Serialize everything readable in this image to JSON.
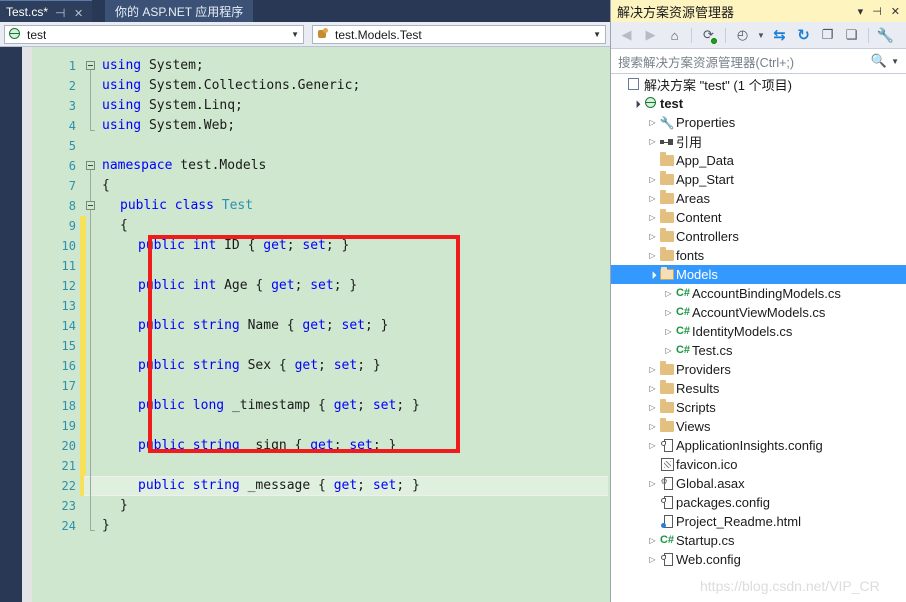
{
  "editor": {
    "tabs": [
      {
        "label": "Test.cs*",
        "active": true,
        "pin_icon": "pin-icon",
        "close_icon": "close-icon"
      },
      {
        "label": "你的 ASP.NET 应用程序",
        "active": false
      }
    ],
    "nav": {
      "project": {
        "value": "test",
        "icon": "project-globe-icon",
        "arrow": "▼"
      },
      "member": {
        "value": "test.Models.Test",
        "icon": "class-icon",
        "arrow": "▼"
      }
    },
    "line_numbers": [
      1,
      2,
      3,
      4,
      5,
      6,
      7,
      8,
      9,
      10,
      11,
      12,
      13,
      14,
      15,
      16,
      17,
      18,
      19,
      20,
      21,
      22,
      23,
      24
    ],
    "current_line": 22,
    "code_lines": [
      {
        "n": 1,
        "indent": 0,
        "tokens": [
          {
            "t": "using ",
            "c": "kw"
          },
          {
            "t": "System;",
            "c": "pl"
          }
        ]
      },
      {
        "n": 2,
        "indent": 0,
        "tokens": [
          {
            "t": "using ",
            "c": "kw"
          },
          {
            "t": "System.Collections.Generic;",
            "c": "pl"
          }
        ]
      },
      {
        "n": 3,
        "indent": 0,
        "tokens": [
          {
            "t": "using ",
            "c": "kw"
          },
          {
            "t": "System.Linq;",
            "c": "pl"
          }
        ]
      },
      {
        "n": 4,
        "indent": 0,
        "tokens": [
          {
            "t": "using ",
            "c": "kw"
          },
          {
            "t": "System.Web;",
            "c": "pl"
          }
        ]
      },
      {
        "n": 5,
        "indent": 0,
        "tokens": []
      },
      {
        "n": 6,
        "indent": 0,
        "tokens": [
          {
            "t": "namespace ",
            "c": "kw"
          },
          {
            "t": "test.Models",
            "c": "pl"
          }
        ]
      },
      {
        "n": 7,
        "indent": 0,
        "tokens": [
          {
            "t": "{",
            "c": "pl"
          }
        ]
      },
      {
        "n": 8,
        "indent": 1,
        "tokens": [
          {
            "t": "public ",
            "c": "kw"
          },
          {
            "t": "class ",
            "c": "kw"
          },
          {
            "t": "Test",
            "c": "ty"
          }
        ]
      },
      {
        "n": 9,
        "indent": 1,
        "tokens": [
          {
            "t": "{",
            "c": "pl"
          }
        ]
      },
      {
        "n": 10,
        "indent": 2,
        "tokens": [
          {
            "t": "public ",
            "c": "kw"
          },
          {
            "t": "int ",
            "c": "kw"
          },
          {
            "t": "ID { ",
            "c": "pl"
          },
          {
            "t": "get",
            "c": "kw"
          },
          {
            "t": "; ",
            "c": "pl"
          },
          {
            "t": "set",
            "c": "kw"
          },
          {
            "t": "; }",
            "c": "pl"
          }
        ]
      },
      {
        "n": 11,
        "indent": 2,
        "tokens": []
      },
      {
        "n": 12,
        "indent": 2,
        "tokens": [
          {
            "t": "public ",
            "c": "kw"
          },
          {
            "t": "int ",
            "c": "kw"
          },
          {
            "t": "Age { ",
            "c": "pl"
          },
          {
            "t": "get",
            "c": "kw"
          },
          {
            "t": "; ",
            "c": "pl"
          },
          {
            "t": "set",
            "c": "kw"
          },
          {
            "t": "; }",
            "c": "pl"
          }
        ]
      },
      {
        "n": 13,
        "indent": 2,
        "tokens": []
      },
      {
        "n": 14,
        "indent": 2,
        "tokens": [
          {
            "t": "public ",
            "c": "kw"
          },
          {
            "t": "string ",
            "c": "kw"
          },
          {
            "t": "Name { ",
            "c": "pl"
          },
          {
            "t": "get",
            "c": "kw"
          },
          {
            "t": "; ",
            "c": "pl"
          },
          {
            "t": "set",
            "c": "kw"
          },
          {
            "t": "; }",
            "c": "pl"
          }
        ]
      },
      {
        "n": 15,
        "indent": 2,
        "tokens": []
      },
      {
        "n": 16,
        "indent": 2,
        "tokens": [
          {
            "t": "public ",
            "c": "kw"
          },
          {
            "t": "string ",
            "c": "kw"
          },
          {
            "t": "Sex { ",
            "c": "pl"
          },
          {
            "t": "get",
            "c": "kw"
          },
          {
            "t": "; ",
            "c": "pl"
          },
          {
            "t": "set",
            "c": "kw"
          },
          {
            "t": "; }",
            "c": "pl"
          }
        ]
      },
      {
        "n": 17,
        "indent": 2,
        "tokens": []
      },
      {
        "n": 18,
        "indent": 2,
        "tokens": [
          {
            "t": "public ",
            "c": "kw"
          },
          {
            "t": "long ",
            "c": "kw"
          },
          {
            "t": "_timestamp { ",
            "c": "pl"
          },
          {
            "t": "get",
            "c": "kw"
          },
          {
            "t": "; ",
            "c": "pl"
          },
          {
            "t": "set",
            "c": "kw"
          },
          {
            "t": "; }",
            "c": "pl"
          }
        ]
      },
      {
        "n": 19,
        "indent": 2,
        "tokens": []
      },
      {
        "n": 20,
        "indent": 2,
        "tokens": [
          {
            "t": "public ",
            "c": "kw"
          },
          {
            "t": "string ",
            "c": "kw"
          },
          {
            "t": "_sign { ",
            "c": "pl"
          },
          {
            "t": "get",
            "c": "kw"
          },
          {
            "t": "; ",
            "c": "pl"
          },
          {
            "t": "set",
            "c": "kw"
          },
          {
            "t": "; }",
            "c": "pl"
          }
        ]
      },
      {
        "n": 21,
        "indent": 2,
        "tokens": []
      },
      {
        "n": 22,
        "indent": 2,
        "tokens": [
          {
            "t": "public ",
            "c": "kw"
          },
          {
            "t": "string ",
            "c": "kw"
          },
          {
            "t": "_message { ",
            "c": "pl"
          },
          {
            "t": "get",
            "c": "kw"
          },
          {
            "t": "; ",
            "c": "pl"
          },
          {
            "t": "set",
            "c": "kw"
          },
          {
            "t": "; }",
            "c": "pl"
          }
        ]
      },
      {
        "n": 23,
        "indent": 1,
        "tokens": [
          {
            "t": "}",
            "c": "pl"
          }
        ]
      },
      {
        "n": 24,
        "indent": 0,
        "tokens": [
          {
            "t": "}",
            "c": "pl"
          }
        ]
      }
    ],
    "annotation": {
      "shape": "rectangle",
      "color": "#ef1c1c"
    },
    "colors": {
      "background": "#cfe6cf",
      "keyword": "#0000ff",
      "type": "#2b91af",
      "plain": "#1a1a1a",
      "line_number": "#2b91af",
      "change_bar": "#f7e05a",
      "current_line": "#dff0df"
    }
  },
  "solution_explorer": {
    "title": "解决方案资源管理器",
    "title_buttons": [
      {
        "name": "dropdown-icon",
        "glyph": "▾"
      },
      {
        "name": "pin-icon",
        "glyph": "⊣"
      },
      {
        "name": "close-icon",
        "glyph": "✕"
      }
    ],
    "toolbar": [
      {
        "name": "back-button",
        "glyph": "◄",
        "state": "disabled"
      },
      {
        "name": "forward-button",
        "glyph": "►",
        "state": "disabled"
      },
      {
        "name": "home-button",
        "glyph": "⌂",
        "state": "enabled"
      },
      {
        "name": "sync-with-active-document-button",
        "glyph": "⟳",
        "state": "enabled"
      },
      {
        "name": "pending-changes-filter-button",
        "glyph": "◔",
        "state": "enabled"
      },
      {
        "name": "pending-changes-dropdown",
        "glyph": "▾",
        "state": "enabled"
      },
      {
        "name": "sync-views-button",
        "glyph": "⇆",
        "state": "enabled"
      },
      {
        "name": "refresh-button",
        "glyph": "↻",
        "state": "enabled"
      },
      {
        "name": "collapse-all-button",
        "glyph": "⧉",
        "state": "enabled"
      },
      {
        "name": "show-all-files-button",
        "glyph": "❐",
        "state": "enabled"
      },
      {
        "name": "properties-button",
        "glyph": "🔧",
        "state": "enabled"
      }
    ],
    "search_placeholder": "搜索解决方案资源管理器(Ctrl+;)",
    "search_value": "",
    "search_icon": "magnifier-icon",
    "tree": [
      {
        "label": "解决方案 \"test\" (1 个项目)",
        "indent": 0,
        "icon": "solution-icon",
        "chevron": "",
        "bold": false
      },
      {
        "label": "test",
        "indent": 1,
        "icon": "project-icon",
        "chevron": "▲",
        "bold": true
      },
      {
        "label": "Properties",
        "indent": 2,
        "icon": "wrench-icon",
        "chevron": "▶",
        "bold": false
      },
      {
        "label": "引用",
        "indent": 2,
        "icon": "references-icon",
        "chevron": "▶",
        "bold": false
      },
      {
        "label": "App_Data",
        "indent": 2,
        "icon": "folder-icon",
        "chevron": "",
        "bold": false
      },
      {
        "label": "App_Start",
        "indent": 2,
        "icon": "folder-icon",
        "chevron": "▶",
        "bold": false
      },
      {
        "label": "Areas",
        "indent": 2,
        "icon": "folder-icon",
        "chevron": "▶",
        "bold": false
      },
      {
        "label": "Content",
        "indent": 2,
        "icon": "folder-icon",
        "chevron": "▶",
        "bold": false
      },
      {
        "label": "Controllers",
        "indent": 2,
        "icon": "folder-icon",
        "chevron": "▶",
        "bold": false
      },
      {
        "label": "fonts",
        "indent": 2,
        "icon": "folder-icon",
        "chevron": "▶",
        "bold": false
      },
      {
        "label": "Models",
        "indent": 2,
        "icon": "folder-open-icon",
        "chevron": "▲",
        "bold": false,
        "selected": true
      },
      {
        "label": "AccountBindingModels.cs",
        "indent": 3,
        "icon": "csharp-file-icon",
        "chevron": "▶",
        "bold": false
      },
      {
        "label": "AccountViewModels.cs",
        "indent": 3,
        "icon": "csharp-file-icon",
        "chevron": "▶",
        "bold": false
      },
      {
        "label": "IdentityModels.cs",
        "indent": 3,
        "icon": "csharp-file-icon",
        "chevron": "▶",
        "bold": false
      },
      {
        "label": "Test.cs",
        "indent": 3,
        "icon": "csharp-file-icon",
        "chevron": "▶",
        "bold": false
      },
      {
        "label": "Providers",
        "indent": 2,
        "icon": "folder-icon",
        "chevron": "▶",
        "bold": false
      },
      {
        "label": "Results",
        "indent": 2,
        "icon": "folder-icon",
        "chevron": "▶",
        "bold": false
      },
      {
        "label": "Scripts",
        "indent": 2,
        "icon": "folder-icon",
        "chevron": "▶",
        "bold": false
      },
      {
        "label": "Views",
        "indent": 2,
        "icon": "folder-icon",
        "chevron": "▶",
        "bold": false
      },
      {
        "label": "ApplicationInsights.config",
        "indent": 2,
        "icon": "config-file-icon",
        "chevron": "▶",
        "bold": false
      },
      {
        "label": "favicon.ico",
        "indent": 2,
        "icon": "icon-file-icon",
        "chevron": "",
        "bold": false
      },
      {
        "label": "Global.asax",
        "indent": 2,
        "icon": "asax-file-icon",
        "chevron": "▶",
        "bold": false
      },
      {
        "label": "packages.config",
        "indent": 2,
        "icon": "config-file-icon",
        "chevron": "",
        "bold": false
      },
      {
        "label": "Project_Readme.html",
        "indent": 2,
        "icon": "html-file-icon",
        "chevron": "",
        "bold": false
      },
      {
        "label": "Startup.cs",
        "indent": 2,
        "icon": "csharp-file-icon",
        "chevron": "▶",
        "bold": false
      },
      {
        "label": "Web.config",
        "indent": 2,
        "icon": "config-file-icon",
        "chevron": "▶",
        "bold": false
      }
    ],
    "selection_color": "#3399ff"
  },
  "watermark": "https://blog.csdn.net/VIP_CR"
}
